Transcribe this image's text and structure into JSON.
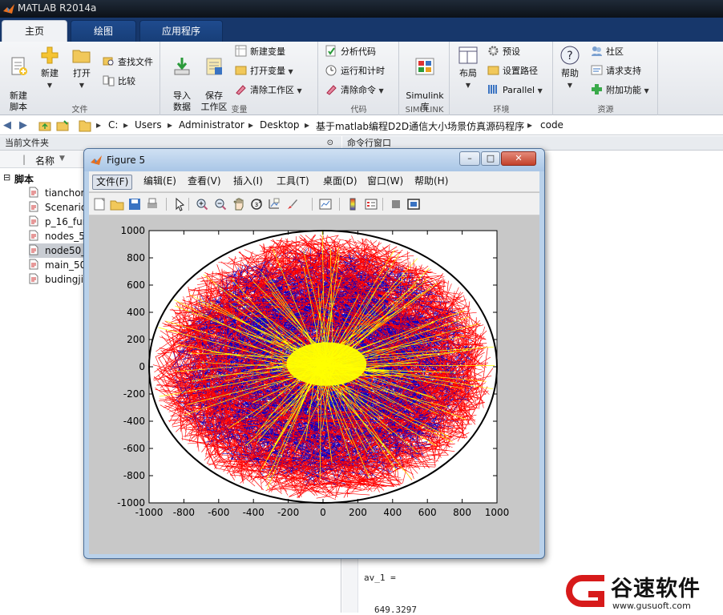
{
  "app": {
    "title": "MATLAB R2014a"
  },
  "tabs": [
    "主页",
    "绘图",
    "应用程序"
  ],
  "ribbon": {
    "file": {
      "label": "文件",
      "new_script": "新建\n脚本",
      "new": "新建",
      "open": "打开",
      "find_files": "查找文件",
      "compare": "比较"
    },
    "variable": {
      "label": "变量",
      "import": "导入\n数据",
      "save_ws": "保存\n工作区",
      "new_var": "新建变量",
      "open_var": "打开变量",
      "clear_ws": "清除工作区"
    },
    "code": {
      "label": "代码",
      "analyze": "分析代码",
      "run_time": "运行和计时",
      "clear_cmd": "清除命令"
    },
    "simulink": {
      "label": "SIMULINK",
      "lib": "Simulink\n库"
    },
    "env": {
      "label": "环境",
      "layout": "布局",
      "prefs": "预设",
      "set_path": "设置路径",
      "parallel": "Parallel"
    },
    "res": {
      "label": "资源",
      "help": "帮助",
      "community": "社区",
      "support": "请求支持",
      "addons": "附加功能"
    }
  },
  "path": [
    "C:",
    "Users",
    "Administrator",
    "Desktop",
    "基于matlab编程D2D通信大小场景仿真源码程序",
    "code"
  ],
  "current_folder": {
    "title": "当前文件夹",
    "col_name": "名称",
    "section": "脚本",
    "files": [
      "tianchor",
      "Scenario",
      "p_16_fur",
      "nodes_5",
      "node50_",
      "main_50",
      "budingji"
    ],
    "selected": 4
  },
  "command_window": {
    "title": "命令行窗口",
    "lines": [
      "av_1 =",
      "649.3297"
    ]
  },
  "figure": {
    "title": "Figure 5",
    "menu": [
      "文件(F)",
      "编辑(E)",
      "查看(V)",
      "插入(I)",
      "工具(T)",
      "桌面(D)",
      "窗口(W)",
      "帮助(H)"
    ],
    "active_menu": 0,
    "toolbar_icons": [
      "new-figure-icon",
      "open-file-icon",
      "save-icon",
      "print-icon",
      "pointer-icon",
      "zoom-in-icon",
      "zoom-out-icon",
      "pan-icon",
      "rotate-3d-icon",
      "data-cursor-icon",
      "brush-icon",
      "link-plot-icon",
      "colorbar-icon",
      "legend-icon",
      "hide-tools-icon",
      "show-tools-icon"
    ]
  },
  "chart_data": {
    "type": "scatter",
    "title": "",
    "xlabel": "",
    "ylabel": "",
    "xlim": [
      -1000,
      1000
    ],
    "ylim": [
      -1000,
      1000
    ],
    "xticks": [
      -1000,
      -800,
      -600,
      -400,
      -200,
      0,
      200,
      400,
      600,
      800,
      1000
    ],
    "yticks": [
      -1000,
      -800,
      -600,
      -400,
      -200,
      0,
      200,
      400,
      600,
      800,
      1000
    ],
    "grid": false,
    "circle": {
      "cx": 0,
      "cy": 0,
      "r": 1000
    },
    "series": [
      {
        "color": "#ff0000",
        "values": "dense line mesh, outer ring (r≈350–1000)"
      },
      {
        "color": "#0000cc",
        "values": "dense line mesh, middle ring (r≈150–900)"
      },
      {
        "color": "#ffff00",
        "values": "line fan around center (r≈0–1000)"
      }
    ]
  },
  "watermark": {
    "text": "谷速软件",
    "url": "www.gusuoft.com"
  }
}
